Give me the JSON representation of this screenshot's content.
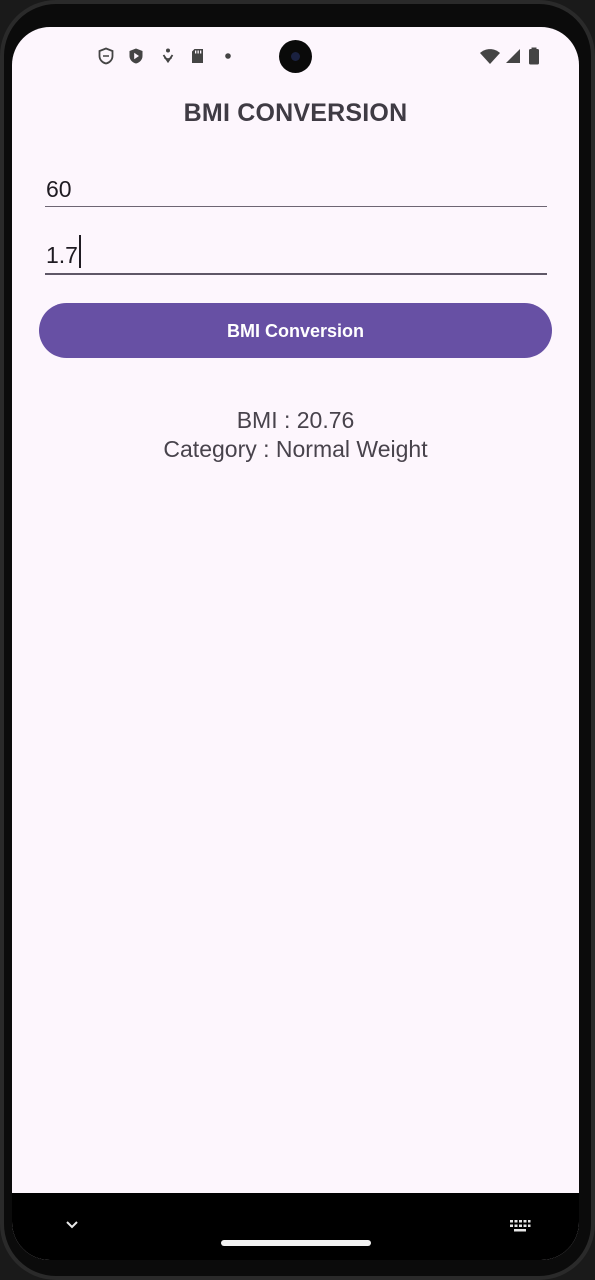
{
  "app": {
    "title": "BMI CONVERSION"
  },
  "inputs": {
    "weight_value": "60",
    "height_value": "1.7"
  },
  "convert_button": {
    "label": "BMI Conversion"
  },
  "result": {
    "bmi_text": "BMI : 20.76",
    "category_text": "Category : Normal Weight"
  },
  "status_bar": {
    "left_icons": [
      "shield-outline-icon",
      "play-protect-icon",
      "accessibility-icon",
      "sd-card-icon",
      "dot-icon"
    ],
    "right_icons": [
      "wifi-icon",
      "cellular-icon",
      "battery-icon"
    ]
  },
  "nav_bar": {
    "icons": [
      "chevron-down-icon",
      "home-pill",
      "keyboard-icon"
    ]
  },
  "colors": {
    "accent": "#6750a4",
    "background": "#fdf6fd",
    "title_text": "#3f3b44",
    "result_text": "#48434c"
  }
}
